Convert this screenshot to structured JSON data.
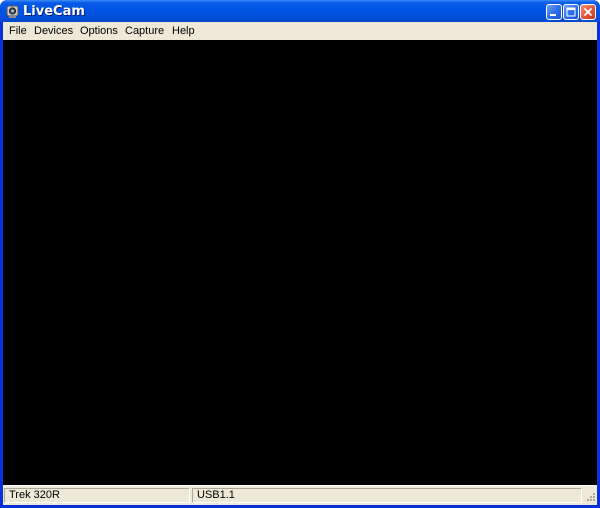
{
  "window": {
    "title": "LiveCam",
    "app_icon": "webcam-icon",
    "controls": [
      "minimize-icon",
      "maximize-icon",
      "close-icon"
    ]
  },
  "menubar": {
    "items": [
      {
        "label": "File"
      },
      {
        "label": "Devices"
      },
      {
        "label": "Options"
      },
      {
        "label": "Capture"
      },
      {
        "label": "Help"
      }
    ]
  },
  "statusbar": {
    "device": "Trek 320R",
    "connection": "USB1.1"
  },
  "colors": {
    "titlebar": "#0054e3",
    "viewport": "#000000",
    "chrome": "#ece9d8"
  }
}
